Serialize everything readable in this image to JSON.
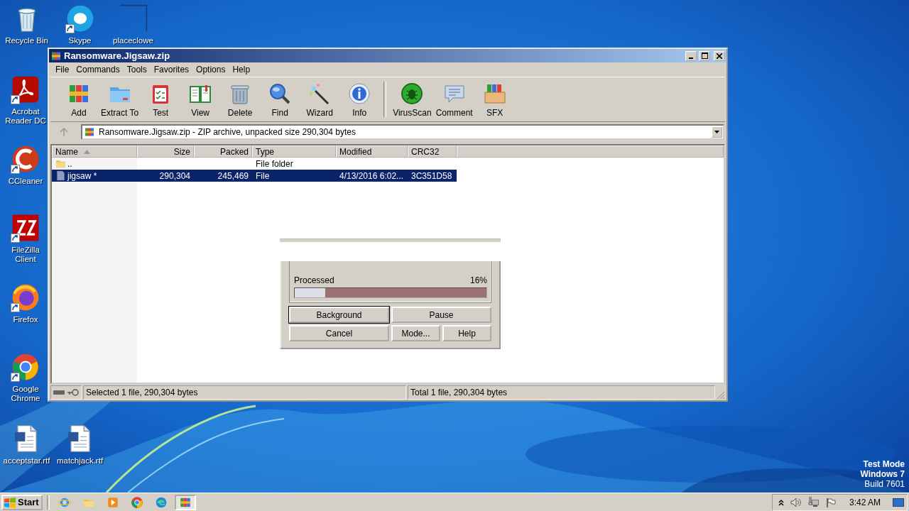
{
  "desktop_icons": [
    {
      "label": "Recycle Bin",
      "kind": "recycle",
      "shortcut": false
    },
    {
      "label": "Skype",
      "kind": "skype",
      "shortcut": true
    },
    {
      "label": "placeclowe",
      "kind": "blank",
      "shortcut": false
    },
    {
      "label": "Acrobat Reader DC",
      "kind": "acrobat",
      "shortcut": true
    },
    {
      "label": "CCleaner",
      "kind": "ccleaner",
      "shortcut": true
    },
    {
      "label": "FileZilla Client",
      "kind": "filezilla",
      "shortcut": true
    },
    {
      "label": "Firefox",
      "kind": "firefox",
      "shortcut": true
    },
    {
      "label": "Google Chrome",
      "kind": "chrome",
      "shortcut": true
    },
    {
      "label": "acceptstar.rtf",
      "kind": "document",
      "shortcut": false
    },
    {
      "label": "matchjack.rtf",
      "kind": "document",
      "shortcut": false
    }
  ],
  "desktop_notice": [
    {
      "text": "Test Mode",
      "bold": true
    },
    {
      "text": "Windows 7",
      "bold": true
    },
    {
      "text": "Build 7601",
      "bold": false
    }
  ],
  "window": {
    "title": "Ransomware.Jigsaw.zip",
    "menu": [
      "File",
      "Commands",
      "Tools",
      "Favorites",
      "Options",
      "Help"
    ],
    "toolbar_groups": [
      {
        "buttons": [
          {
            "label": "Add",
            "kind": "add"
          },
          {
            "label": "Extract To",
            "kind": "extract"
          },
          {
            "label": "Test",
            "kind": "test"
          },
          {
            "label": "View",
            "kind": "view"
          },
          {
            "label": "Delete",
            "kind": "delete"
          },
          {
            "label": "Find",
            "kind": "find"
          },
          {
            "label": "Wizard",
            "kind": "wizard"
          },
          {
            "label": "Info",
            "kind": "info"
          }
        ]
      },
      {
        "buttons": [
          {
            "label": "VirusScan",
            "kind": "virusscan"
          },
          {
            "label": "Comment",
            "kind": "comment"
          },
          {
            "label": "SFX",
            "kind": "sfx"
          }
        ]
      }
    ],
    "address": "Ransomware.Jigsaw.zip - ZIP archive, unpacked size 290,304 bytes",
    "columns": [
      {
        "label": "Name",
        "sorted": true
      },
      {
        "label": "Size",
        "sorted": false
      },
      {
        "label": "Packed",
        "sorted": false
      },
      {
        "label": "Type",
        "sorted": false
      },
      {
        "label": "Modified",
        "sorted": false
      },
      {
        "label": "CRC32",
        "sorted": false
      }
    ],
    "rows": [
      {
        "kind": "folder",
        "name": "..",
        "size": "",
        "packed": "",
        "type": "File folder",
        "modified": "",
        "crc32": "",
        "selected": false
      },
      {
        "kind": "file",
        "name": "jigsaw *",
        "size": "290,304",
        "packed": "245,469",
        "type": "File",
        "modified": "4/13/2016 6:02...",
        "crc32": "3C351D58",
        "selected": true
      }
    ],
    "status_left": "Selected 1 file, 290,304 bytes",
    "status_right": "Total 1 file, 290,304 bytes"
  },
  "progress_dialog": {
    "label": "Processed",
    "reading": "16%",
    "level": 0.16,
    "button_rows": [
      [
        {
          "label": "Background",
          "default": true
        },
        {
          "label": "Pause",
          "default": false
        }
      ],
      [
        {
          "label": "Cancel",
          "default": false
        },
        {
          "label": "Mode...",
          "default": false
        },
        {
          "label": "Help",
          "default": false
        }
      ]
    ]
  },
  "taskbar": {
    "start": "Start",
    "apps": [
      {
        "kind": "ie",
        "active": false
      },
      {
        "kind": "explorer",
        "active": false
      },
      {
        "kind": "media",
        "active": false
      },
      {
        "kind": "chrome",
        "active": false
      },
      {
        "kind": "edge",
        "active": false
      },
      {
        "kind": "winrar",
        "active": true
      }
    ],
    "clock": "3:42 AM"
  }
}
